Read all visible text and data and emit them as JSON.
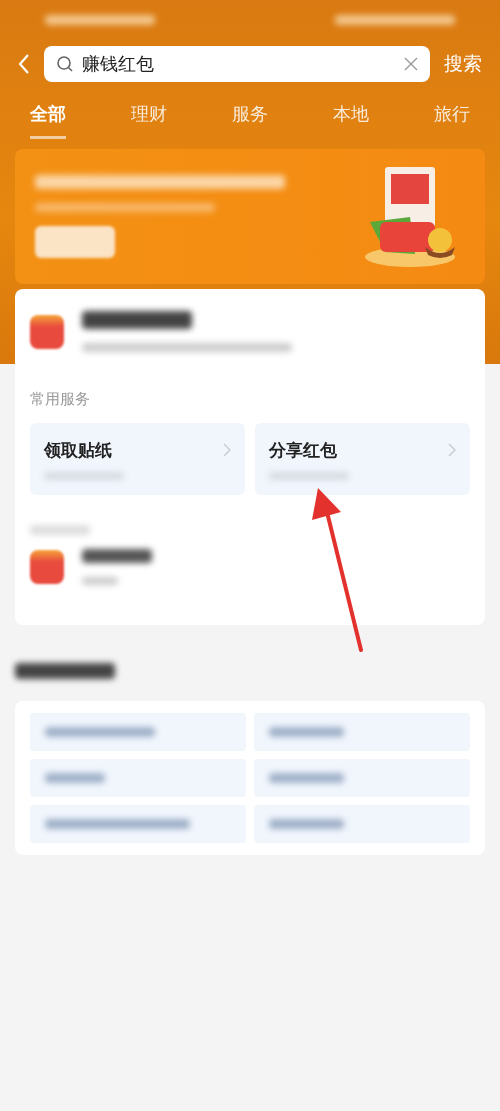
{
  "search": {
    "value": "赚钱红包",
    "button": "搜索"
  },
  "tabs": [
    {
      "label": "全部",
      "selected": true
    },
    {
      "label": "理财",
      "selected": false
    },
    {
      "label": "服务",
      "selected": false
    },
    {
      "label": "本地",
      "selected": false
    },
    {
      "label": "旅行",
      "selected": false
    }
  ],
  "services": {
    "heading": "常用服务",
    "items": [
      {
        "title": "领取贴纸"
      },
      {
        "title": "分享红包"
      }
    ]
  }
}
